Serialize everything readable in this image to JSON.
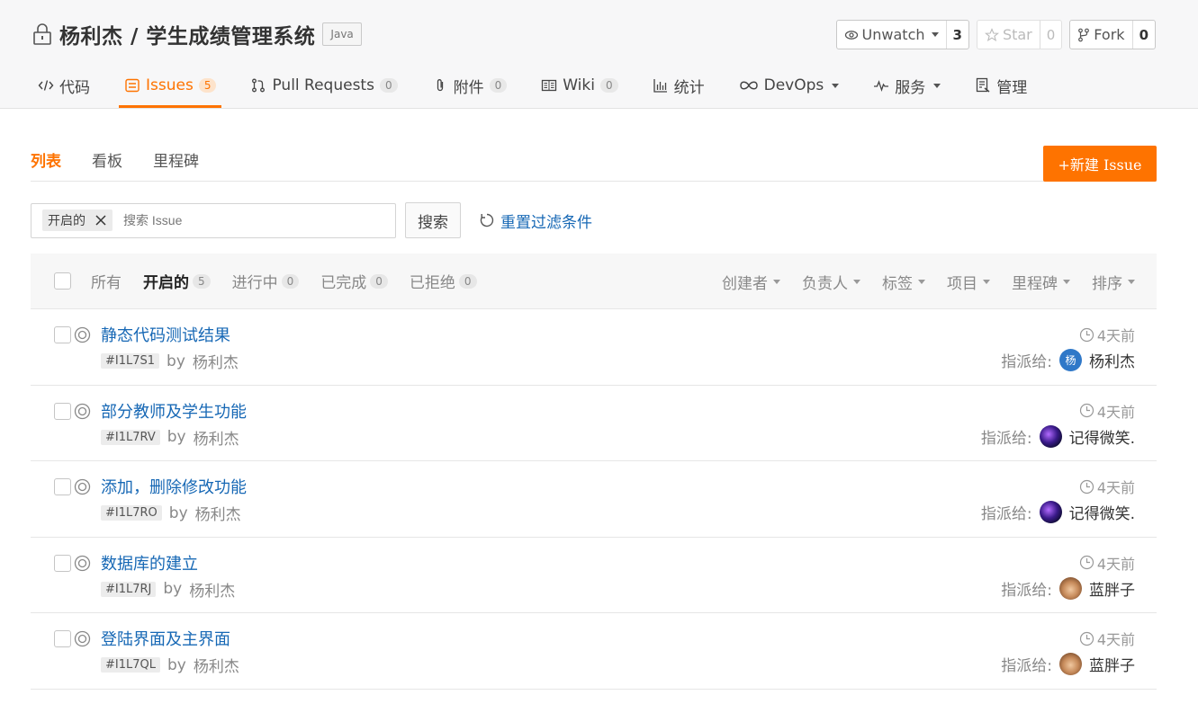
{
  "repo": {
    "owner_repo": "杨利杰 / 学生成绩管理系统",
    "language": "Java",
    "actions": [
      {
        "label": "Unwatch",
        "count": "3",
        "icon": "eye-icon",
        "disabled": false,
        "dropdown": true
      },
      {
        "label": "Star",
        "count": "0",
        "icon": "star-icon",
        "disabled": true,
        "dropdown": false
      },
      {
        "label": "Fork",
        "count": "0",
        "icon": "fork-icon",
        "disabled": false,
        "dropdown": false
      }
    ]
  },
  "nav": [
    {
      "label": "代码",
      "icon": "code-icon"
    },
    {
      "label": "Issues",
      "badge": "5",
      "icon": "issues-icon",
      "active": true
    },
    {
      "label": "Pull Requests",
      "badge": "0",
      "icon": "pull-request-icon"
    },
    {
      "label": "附件",
      "badge": "0",
      "icon": "attachment-icon"
    },
    {
      "label": "Wiki",
      "badge": "0",
      "icon": "wiki-icon"
    },
    {
      "label": "统计",
      "icon": "stats-icon"
    },
    {
      "label": "DevOps",
      "icon": "devops-icon",
      "dropdown": true
    },
    {
      "label": "服务",
      "icon": "service-icon",
      "dropdown": true
    },
    {
      "label": "管理",
      "icon": "manage-icon"
    }
  ],
  "subtabs": [
    "列表",
    "看板",
    "里程碑"
  ],
  "new_issue": "+新建 Issue",
  "search": {
    "chip": "开启的",
    "placeholder": "搜索 Issue",
    "button": "搜索",
    "reset": "重置过滤条件"
  },
  "states": [
    {
      "label": "所有"
    },
    {
      "label": "开启的",
      "count": "5",
      "active": true
    },
    {
      "label": "进行中",
      "count": "0"
    },
    {
      "label": "已完成",
      "count": "0"
    },
    {
      "label": "已拒绝",
      "count": "0"
    }
  ],
  "sorts": [
    "创建者",
    "负责人",
    "标签",
    "项目",
    "里程碑",
    "排序"
  ],
  "assign_label": "指派给:",
  "issues": [
    {
      "title": "静态代码测试结果",
      "id": "#I1L7S1",
      "by": "by",
      "author": "杨利杰",
      "time": "4天前",
      "assignee": "杨利杰",
      "avatar": "blue",
      "avatar_text": "杨"
    },
    {
      "title": "部分教师及学生功能",
      "id": "#I1L7RV",
      "by": "by",
      "author": "杨利杰",
      "time": "4天前",
      "assignee": "记得微笑.",
      "avatar": "galaxy",
      "avatar_text": ""
    },
    {
      "title": "添加，删除修改功能",
      "id": "#I1L7RO",
      "by": "by",
      "author": "杨利杰",
      "time": "4天前",
      "assignee": "记得微笑.",
      "avatar": "galaxy",
      "avatar_text": ""
    },
    {
      "title": "数据库的建立",
      "id": "#I1L7RJ",
      "by": "by",
      "author": "杨利杰",
      "time": "4天前",
      "assignee": "蓝胖子",
      "avatar": "monkey",
      "avatar_text": ""
    },
    {
      "title": "登陆界面及主界面",
      "id": "#I1L7QL",
      "by": "by",
      "author": "杨利杰",
      "time": "4天前",
      "assignee": "蓝胖子",
      "avatar": "monkey",
      "avatar_text": ""
    }
  ],
  "colors": {
    "accent": "#fe7300",
    "link": "#1768b5"
  }
}
